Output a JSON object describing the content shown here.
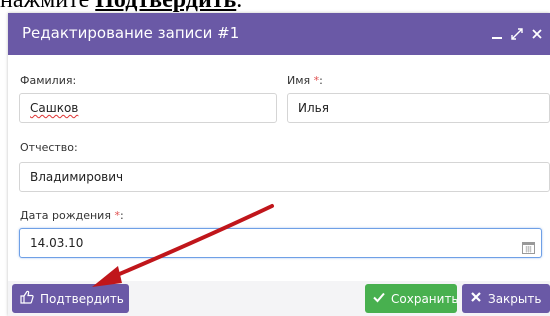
{
  "doc": {
    "prefix": "нажмите ",
    "bold": "Подтвердить",
    "suffix": "."
  },
  "dialog": {
    "title": "Редактирование записи #1",
    "title_bg": "#6a59a6"
  },
  "form": {
    "surname": {
      "label": "Фамилия:",
      "value": "Сашков"
    },
    "name": {
      "label": "Имя",
      "required_mark": "*",
      "colon": ":",
      "value": "Илья"
    },
    "patronymic": {
      "label": "Отчество:",
      "value": "Владимирович"
    },
    "birthdate": {
      "label": "Дата рождения",
      "required_mark": "*",
      "colon": ":",
      "value": "14.03.10"
    }
  },
  "footer": {
    "confirm_label": "Подтвердить",
    "save_label": "Сохранить",
    "close_label": "Закрыть",
    "save_color": "#48b04f",
    "accent_color": "#6a59a6"
  },
  "annotation": {
    "arrow_color": "#c0161b"
  }
}
